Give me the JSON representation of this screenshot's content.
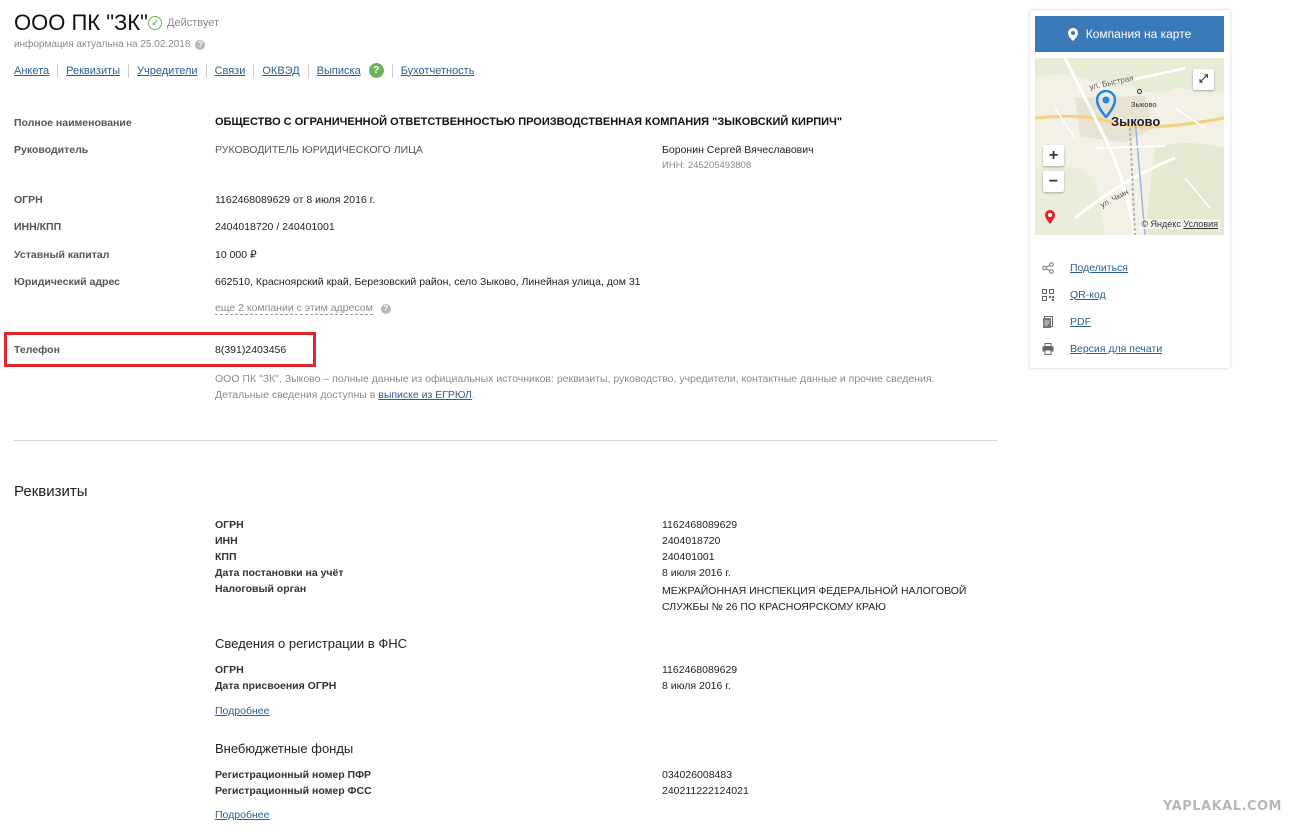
{
  "header": {
    "title": "ООО ПК \"ЗК\"",
    "status": "Действует",
    "actual_info": "информация актуальна на 25.02.2018",
    "tabs": [
      "Анкета",
      "Реквизиты",
      "Учредители",
      "Связи",
      "ОКВЭД",
      "Выписка",
      "Бухотчетность"
    ],
    "tab_help_badge": "?"
  },
  "info": {
    "full_name_label": "Полное наименование",
    "full_name": "ОБЩЕСТВО С ОГРАНИЧЕННОЙ ОТВЕТСТВЕННОСТЬЮ ПРОИЗВОДСТВЕННАЯ КОМПАНИЯ \"ЗЫКОВСКИЙ КИРПИЧ\"",
    "head_label": "Руководитель",
    "head_position": "РУКОВОДИТЕЛЬ ЮРИДИЧЕСКОГО ЛИЦА",
    "head_name": "Боронин Сергей Вячеславович",
    "head_inn": "ИНН: 245205493808",
    "ogrn_label": "ОГРН",
    "ogrn": "1162468089629 от 8 июля 2016 г.",
    "inn_kpp_label": "ИНН/КПП",
    "inn_kpp": "2404018720 / 240401001",
    "capital_label": "Уставный капитал",
    "capital": "10 000 ₽",
    "address_label": "Юридический адрес",
    "address": "662510, Красноярский край, Березовский район, село Зыково, Линейная улица, дом 31",
    "same_address": "еще 2 компании с этим адресом",
    "phone_label": "Телефон",
    "phone": "8(391)2403456",
    "description_1": "ООО ПК \"ЗК\", Зыково – полные данные из официальных источников: реквизиты, руководство, учредители, контактные данные и прочие сведения.",
    "description_2": "Детальные сведения доступны в ",
    "description_link": "выписке из ЕГРЮЛ",
    "description_end": "."
  },
  "requisites": {
    "title": "Реквизиты",
    "rows": [
      {
        "label": "ОГРН",
        "value": "1162468089629"
      },
      {
        "label": "ИНН",
        "value": "2404018720"
      },
      {
        "label": "КПП",
        "value": "240401001"
      },
      {
        "label": "Дата постановки на учёт",
        "value": "8 июля 2016 г."
      },
      {
        "label": "Налоговый орган",
        "value": "МЕЖРАЙОННАЯ ИНСПЕКЦИЯ ФЕДЕРАЛЬНОЙ НАЛОГОВОЙ СЛУЖБЫ № 26 ПО КРАСНОЯРСКОМУ КРАЮ"
      }
    ],
    "fns": {
      "title": "Сведения о регистрации в ФНС",
      "rows": [
        {
          "label": "ОГРН",
          "value": "1162468089629"
        },
        {
          "label": "Дата присвоения ОГРН",
          "value": "8 июля 2016 г."
        }
      ],
      "more": "Подробнее"
    },
    "funds": {
      "title": "Внебюджетные фонды",
      "rows": [
        {
          "label": "Регистрационный номер ПФР",
          "value": "034026008483"
        },
        {
          "label": "Регистрационный номер ФСС",
          "value": "240211222124021"
        }
      ],
      "more": "Подробнее"
    }
  },
  "sidebar": {
    "map_button": "Компания на карте",
    "map": {
      "town": "Зыково",
      "town_small": "Зыково",
      "street_1": "ул. Быстрая",
      "street_2": "ул. Чкин",
      "copyright": "© Яндекс",
      "terms": "Условия",
      "zoom_in": "+",
      "zoom_out": "−"
    },
    "actions": [
      "Поделиться",
      "QR-код",
      "PDF",
      "Версия для печати"
    ]
  },
  "watermark": "YAPLAKAL.COM",
  "colors": {
    "accent": "#3a7ab9",
    "link": "#2a5f8f",
    "status_green": "#6cb35c",
    "highlight_red": "#e0262d"
  }
}
